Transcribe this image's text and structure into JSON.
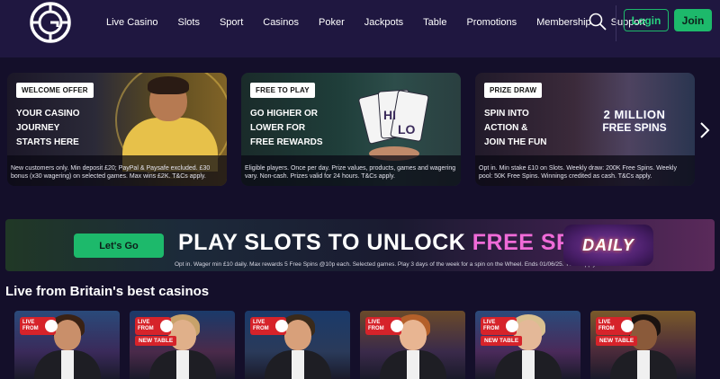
{
  "nav": {
    "items": [
      "Live Casino",
      "Slots",
      "Sport",
      "Casinos",
      "Poker",
      "Jackpots",
      "Table",
      "Promotions",
      "Membership",
      "Support"
    ],
    "login_label": "Login",
    "join_label": "Join"
  },
  "promos": [
    {
      "badge": "WELCOME OFFER",
      "title": "YOUR CASINO\nJOURNEY\nSTARTS HERE",
      "terms": "New customers only. Min deposit £20; PayPal & Paysafe excluded. £30 bonus (x30 wagering) on selected games. Max wins £2K. T&Cs apply."
    },
    {
      "badge": "FREE TO PLAY",
      "title": "GO HIGHER OR\nLOWER FOR\nFREE REWARDS",
      "terms": "Eligible players. Once per day. Prize values, products, games and wagering vary. Non-cash. Prizes valid for 24 hours. T&Cs apply."
    },
    {
      "badge": "PRIZE DRAW",
      "title": "SPIN INTO\nACTION &\nJOIN THE FUN",
      "terms": "Opt in. Min stake £10 on Slots. Weekly draw: 200K Free Spins. Weekly pool: 50K Free Spins. Winnings credited as cash. T&Cs apply.",
      "art_line1": "2 MILLION",
      "art_line2": "FREE SPINS"
    }
  ],
  "banner": {
    "button_label": "Let's Go",
    "headline_part1": "PLAY SLOTS TO ",
    "headline_part2": "UNLOCK ",
    "headline_part3": "FREE SPINS",
    "badge_text": "DAILY",
    "terms": "Opt in. Wager min £10 daily. Max rewards 5 Free Spins @10p each. Selected games. Play 3 days of the week for a spin on the Wheel. Ends 01/06/25. T&Cs apply."
  },
  "live_section": {
    "title": "Live from Britain's best casinos",
    "live_tag": "LIVE\nFROM",
    "new_table_label": "NEW TABLE",
    "tiles": [
      {
        "new_table": false
      },
      {
        "new_table": true
      },
      {
        "new_table": false
      },
      {
        "new_table": false
      },
      {
        "new_table": true
      },
      {
        "new_table": true
      }
    ]
  },
  "colors": {
    "header_bg": "#1f1740",
    "page_bg": "#140f2a",
    "accent_green": "#1db96b",
    "live_red": "#d6232a",
    "free_spins_pink": "#f06bd8"
  },
  "icons": [
    "logo-g-icon",
    "search-icon",
    "chevron-right-icon"
  ]
}
